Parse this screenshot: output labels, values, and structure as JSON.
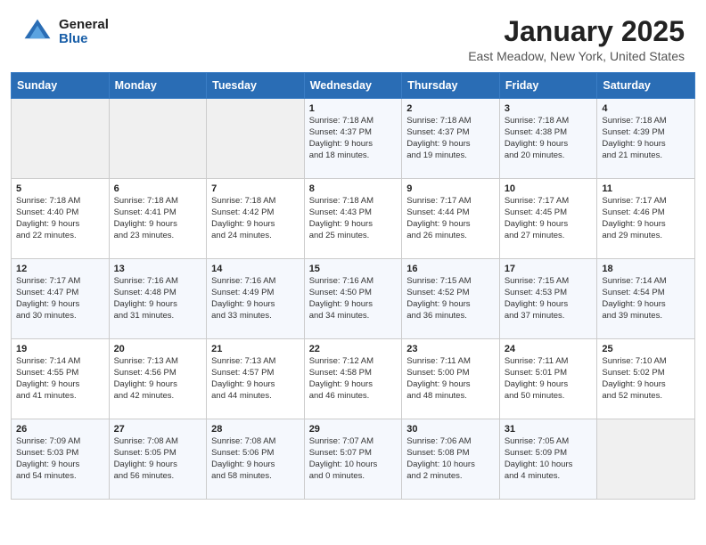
{
  "header": {
    "logo_general": "General",
    "logo_blue": "Blue",
    "title": "January 2025",
    "location": "East Meadow, New York, United States"
  },
  "days_of_week": [
    "Sunday",
    "Monday",
    "Tuesday",
    "Wednesday",
    "Thursday",
    "Friday",
    "Saturday"
  ],
  "weeks": [
    [
      {
        "day": "",
        "info": ""
      },
      {
        "day": "",
        "info": ""
      },
      {
        "day": "",
        "info": ""
      },
      {
        "day": "1",
        "info": "Sunrise: 7:18 AM\nSunset: 4:37 PM\nDaylight: 9 hours\nand 18 minutes."
      },
      {
        "day": "2",
        "info": "Sunrise: 7:18 AM\nSunset: 4:37 PM\nDaylight: 9 hours\nand 19 minutes."
      },
      {
        "day": "3",
        "info": "Sunrise: 7:18 AM\nSunset: 4:38 PM\nDaylight: 9 hours\nand 20 minutes."
      },
      {
        "day": "4",
        "info": "Sunrise: 7:18 AM\nSunset: 4:39 PM\nDaylight: 9 hours\nand 21 minutes."
      }
    ],
    [
      {
        "day": "5",
        "info": "Sunrise: 7:18 AM\nSunset: 4:40 PM\nDaylight: 9 hours\nand 22 minutes."
      },
      {
        "day": "6",
        "info": "Sunrise: 7:18 AM\nSunset: 4:41 PM\nDaylight: 9 hours\nand 23 minutes."
      },
      {
        "day": "7",
        "info": "Sunrise: 7:18 AM\nSunset: 4:42 PM\nDaylight: 9 hours\nand 24 minutes."
      },
      {
        "day": "8",
        "info": "Sunrise: 7:18 AM\nSunset: 4:43 PM\nDaylight: 9 hours\nand 25 minutes."
      },
      {
        "day": "9",
        "info": "Sunrise: 7:17 AM\nSunset: 4:44 PM\nDaylight: 9 hours\nand 26 minutes."
      },
      {
        "day": "10",
        "info": "Sunrise: 7:17 AM\nSunset: 4:45 PM\nDaylight: 9 hours\nand 27 minutes."
      },
      {
        "day": "11",
        "info": "Sunrise: 7:17 AM\nSunset: 4:46 PM\nDaylight: 9 hours\nand 29 minutes."
      }
    ],
    [
      {
        "day": "12",
        "info": "Sunrise: 7:17 AM\nSunset: 4:47 PM\nDaylight: 9 hours\nand 30 minutes."
      },
      {
        "day": "13",
        "info": "Sunrise: 7:16 AM\nSunset: 4:48 PM\nDaylight: 9 hours\nand 31 minutes."
      },
      {
        "day": "14",
        "info": "Sunrise: 7:16 AM\nSunset: 4:49 PM\nDaylight: 9 hours\nand 33 minutes."
      },
      {
        "day": "15",
        "info": "Sunrise: 7:16 AM\nSunset: 4:50 PM\nDaylight: 9 hours\nand 34 minutes."
      },
      {
        "day": "16",
        "info": "Sunrise: 7:15 AM\nSunset: 4:52 PM\nDaylight: 9 hours\nand 36 minutes."
      },
      {
        "day": "17",
        "info": "Sunrise: 7:15 AM\nSunset: 4:53 PM\nDaylight: 9 hours\nand 37 minutes."
      },
      {
        "day": "18",
        "info": "Sunrise: 7:14 AM\nSunset: 4:54 PM\nDaylight: 9 hours\nand 39 minutes."
      }
    ],
    [
      {
        "day": "19",
        "info": "Sunrise: 7:14 AM\nSunset: 4:55 PM\nDaylight: 9 hours\nand 41 minutes."
      },
      {
        "day": "20",
        "info": "Sunrise: 7:13 AM\nSunset: 4:56 PM\nDaylight: 9 hours\nand 42 minutes."
      },
      {
        "day": "21",
        "info": "Sunrise: 7:13 AM\nSunset: 4:57 PM\nDaylight: 9 hours\nand 44 minutes."
      },
      {
        "day": "22",
        "info": "Sunrise: 7:12 AM\nSunset: 4:58 PM\nDaylight: 9 hours\nand 46 minutes."
      },
      {
        "day": "23",
        "info": "Sunrise: 7:11 AM\nSunset: 5:00 PM\nDaylight: 9 hours\nand 48 minutes."
      },
      {
        "day": "24",
        "info": "Sunrise: 7:11 AM\nSunset: 5:01 PM\nDaylight: 9 hours\nand 50 minutes."
      },
      {
        "day": "25",
        "info": "Sunrise: 7:10 AM\nSunset: 5:02 PM\nDaylight: 9 hours\nand 52 minutes."
      }
    ],
    [
      {
        "day": "26",
        "info": "Sunrise: 7:09 AM\nSunset: 5:03 PM\nDaylight: 9 hours\nand 54 minutes."
      },
      {
        "day": "27",
        "info": "Sunrise: 7:08 AM\nSunset: 5:05 PM\nDaylight: 9 hours\nand 56 minutes."
      },
      {
        "day": "28",
        "info": "Sunrise: 7:08 AM\nSunset: 5:06 PM\nDaylight: 9 hours\nand 58 minutes."
      },
      {
        "day": "29",
        "info": "Sunrise: 7:07 AM\nSunset: 5:07 PM\nDaylight: 10 hours\nand 0 minutes."
      },
      {
        "day": "30",
        "info": "Sunrise: 7:06 AM\nSunset: 5:08 PM\nDaylight: 10 hours\nand 2 minutes."
      },
      {
        "day": "31",
        "info": "Sunrise: 7:05 AM\nSunset: 5:09 PM\nDaylight: 10 hours\nand 4 minutes."
      },
      {
        "day": "",
        "info": ""
      }
    ]
  ]
}
